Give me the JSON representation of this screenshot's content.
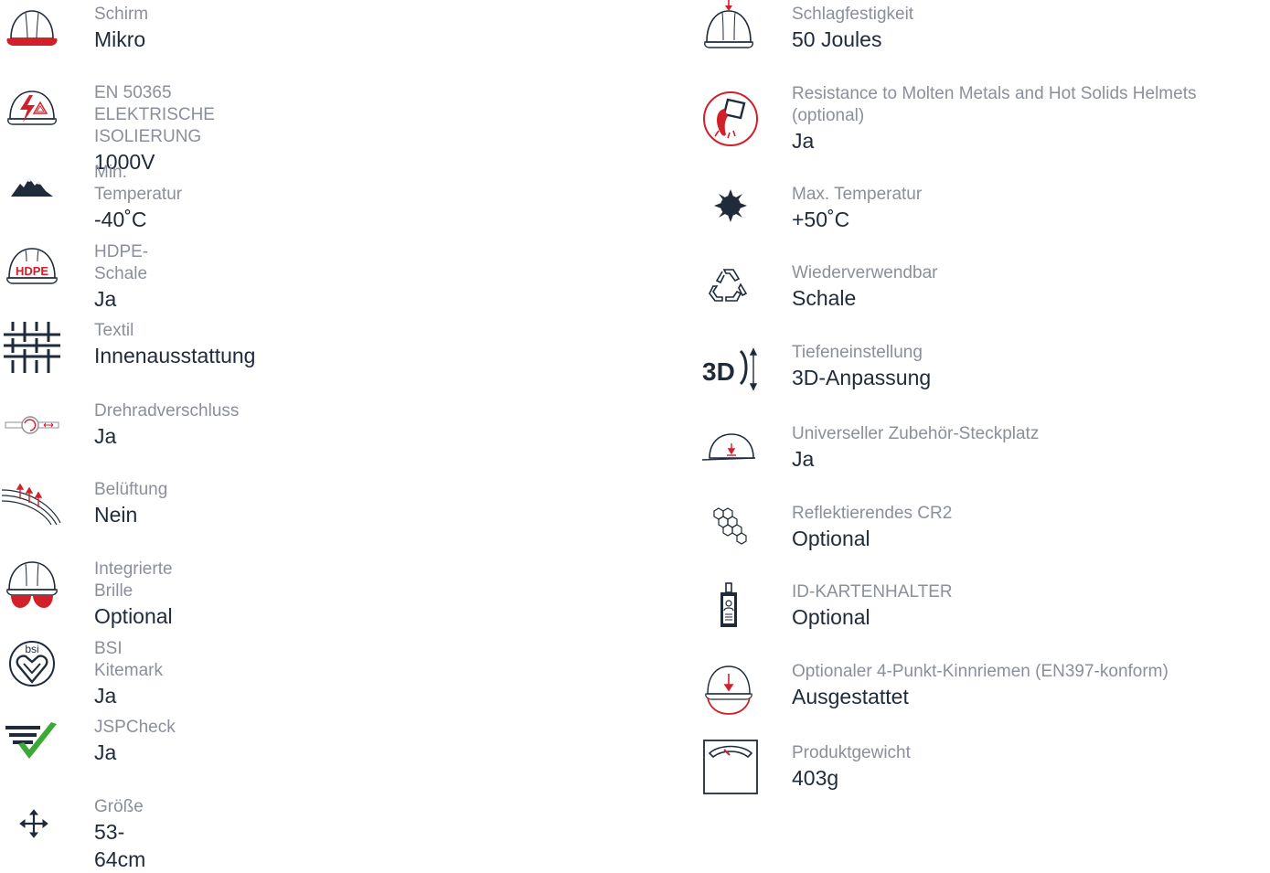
{
  "colors": {
    "navy": "#1f2a3a",
    "red": "#d1202a",
    "green": "#3aa935",
    "label_gray": "#8a8f99"
  },
  "left": [
    {
      "icon": "helmet-peak-icon",
      "label": "Schirm",
      "value": "Mikro"
    },
    {
      "icon": "electrical-insulation-icon",
      "label": "EN 50365 ELEKTRISCHE ISOLIERUNG",
      "value": "1000V"
    },
    {
      "icon": "mountains-icon",
      "label": "Min. Temperatur",
      "value": "-40˚C"
    },
    {
      "icon": "hdpe-shell-icon",
      "label": "HDPE-Schale",
      "hdpe_text": "HDPE",
      "value": "Ja"
    },
    {
      "icon": "textile-grid-icon",
      "label": "Textil",
      "value": "Innenausstattung"
    },
    {
      "icon": "wheel-ratchet-icon",
      "label": "Drehradverschluss",
      "value": "Ja"
    },
    {
      "icon": "ventilation-icon",
      "label": "Belüftung",
      "value": "Nein"
    },
    {
      "icon": "goggles-helmet-icon",
      "label": "Integrierte Brille",
      "value": "Optional"
    },
    {
      "icon": "bsi-kitemark-icon",
      "label": "BSI Kitemark",
      "bsi_text": "bsi",
      "value": "Ja"
    },
    {
      "icon": "jspcheck-icon",
      "label": "JSPCheck",
      "value": "Ja"
    },
    {
      "icon": "size-arrows-icon",
      "label": "Größe",
      "value": "53-64cm"
    }
  ],
  "right": [
    {
      "icon": "impact-helmet-icon",
      "label": "Schlagfestigkeit",
      "value": "50 Joules"
    },
    {
      "icon": "molten-metal-icon",
      "label": "Resistance to Molten Metals and Hot Solids Helmets (optional)",
      "value": "Ja"
    },
    {
      "icon": "sun-icon",
      "label": "Max. Temperatur",
      "value": "+50˚C"
    },
    {
      "icon": "recycle-icon",
      "label": "Wiederverwendbar",
      "value": "Schale"
    },
    {
      "icon": "depth-3d-icon",
      "label": "Tiefeneinstellung",
      "d3_text": "3D",
      "value": "3D-Anpassung"
    },
    {
      "icon": "accessory-slot-icon",
      "label": "Universeller Zubehör-Steckplatz",
      "value": "Ja"
    },
    {
      "icon": "reflective-hexagon-icon",
      "label": "Reflektierendes CR2",
      "value": "Optional"
    },
    {
      "icon": "id-card-holder-icon",
      "label": "ID-KARTENHALTER",
      "value": "Optional"
    },
    {
      "icon": "chin-strap-icon",
      "label": "Optionaler 4-Punkt-Kinnriemen (EN397-konform)",
      "value": "Ausgestattet"
    },
    {
      "icon": "weight-scale-icon",
      "label": "Produktgewicht",
      "value": "403g"
    }
  ]
}
